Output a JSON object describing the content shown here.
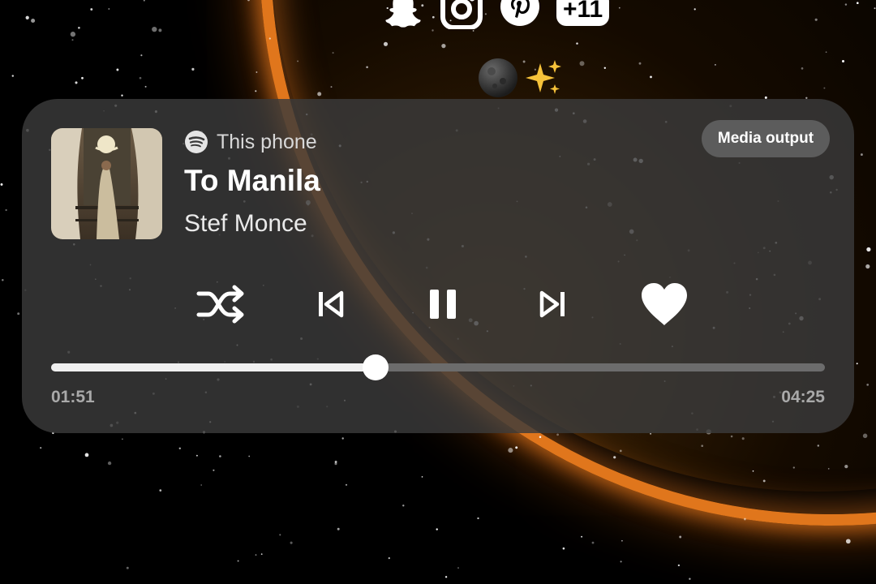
{
  "notification_icons": {
    "icons": [
      "snapchat-icon",
      "instagram-icon",
      "pinterest-icon"
    ],
    "more_count": "+11"
  },
  "status_emojis": [
    "new-moon-icon",
    "sparkles-icon"
  ],
  "media_player": {
    "source_label": "This phone",
    "source_app_icon": "spotify-icon",
    "track_title": "To Manila",
    "artist": "Stef Monce",
    "output_button_label": "Media output",
    "controls": [
      "shuffle-icon",
      "previous-icon",
      "pause-icon",
      "next-icon",
      "heart-icon"
    ],
    "elapsed": "01:51",
    "duration": "04:25",
    "progress_fraction": 0.419
  },
  "colors": {
    "card_bg": "#3a3a3a",
    "accent_orange": "#e0761c",
    "text_primary": "#ffffff",
    "text_secondary": "#a9a9a9"
  }
}
